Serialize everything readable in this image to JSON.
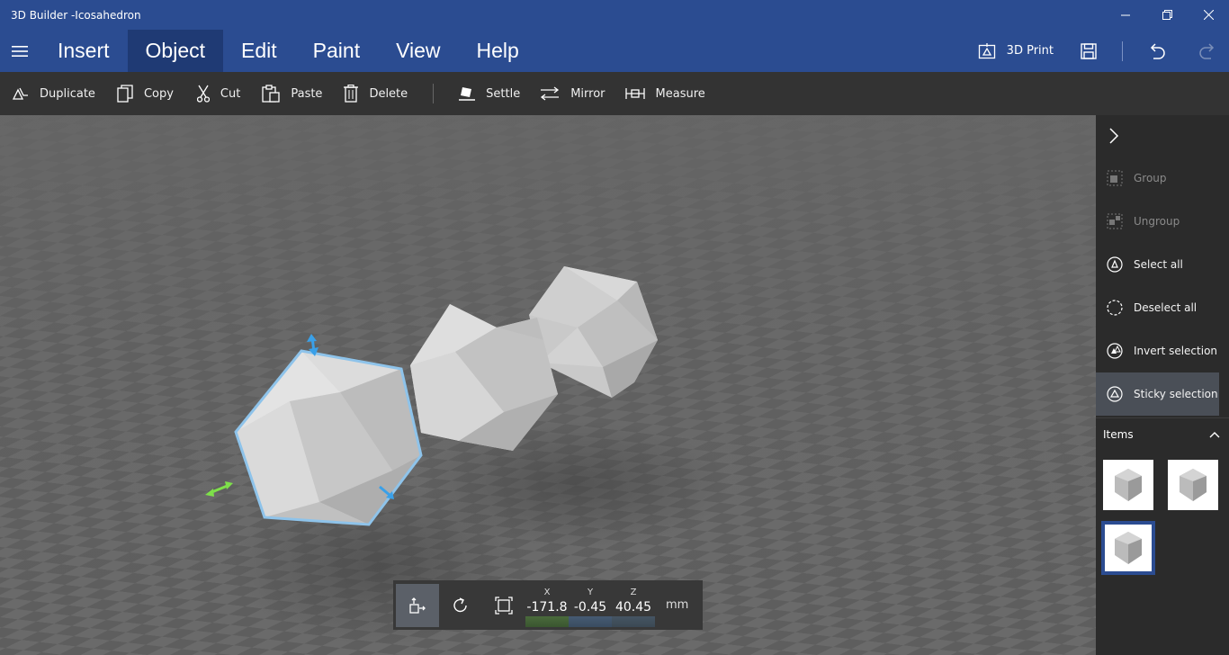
{
  "window": {
    "title": "3D Builder -Icosahedron"
  },
  "menu": {
    "items": [
      "Insert",
      "Object",
      "Edit",
      "Paint",
      "View",
      "Help"
    ],
    "active": "Object",
    "print_label": "3D Print"
  },
  "toolbar": {
    "duplicate": "Duplicate",
    "copy": "Copy",
    "cut": "Cut",
    "paste": "Paste",
    "delete": "Delete",
    "settle": "Settle",
    "mirror": "Mirror",
    "measure": "Measure"
  },
  "sidepanel": {
    "group": "Group",
    "ungroup": "Ungroup",
    "select_all": "Select all",
    "deselect_all": "Deselect all",
    "invert_selection": "Invert selection",
    "sticky_selection": "Sticky selection",
    "items_header": "Items"
  },
  "hud": {
    "x_label": "X",
    "x_value": "-171.8",
    "y_label": "Y",
    "y_value": "-0.45",
    "z_label": "Z",
    "z_value": "40.45",
    "unit": "mm"
  },
  "colors": {
    "accent": "#2b4c91",
    "selection": "#8ec3ea",
    "gizmo_blue": "#3aa0e8",
    "gizmo_green": "#7ee04a"
  }
}
